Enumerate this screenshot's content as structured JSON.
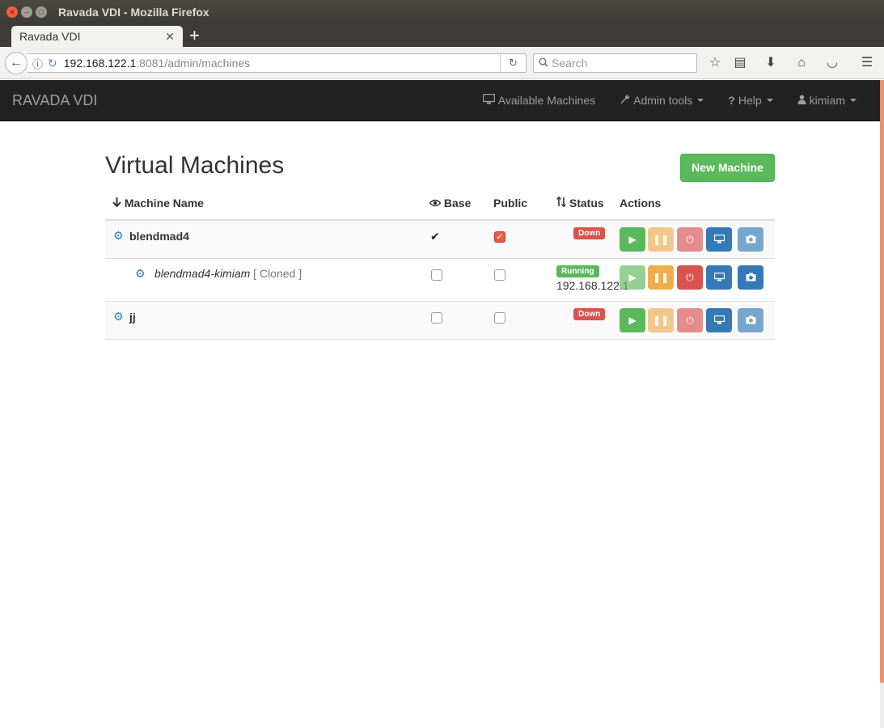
{
  "window": {
    "title": "Ravada VDI - Mozilla Firefox"
  },
  "browser": {
    "tab_title": "Ravada VDI",
    "url_host": "192.168.122.1",
    "url_path": ":8081/admin/machines",
    "search_placeholder": "Search"
  },
  "app": {
    "brand": "RAVADA VDI",
    "nav": {
      "available": "Available Machines",
      "admin": "Admin tools",
      "help": "Help",
      "user": "kimiam"
    }
  },
  "main": {
    "title": "Virtual Machines",
    "new_button": "New Machine",
    "columns": {
      "name": "Machine Name",
      "base": "Base",
      "public": "Public",
      "status": "Status",
      "actions": "Actions"
    },
    "machines": [
      {
        "name": "blendmad4",
        "is_base": true,
        "is_public": true,
        "status": "Down",
        "ip": ""
      },
      {
        "name": "blendmad4-kimiam",
        "clone_tag": "[ Cloned ]",
        "is_base": false,
        "is_public": false,
        "status": "Running",
        "ip": "192.168.122.1"
      },
      {
        "name": "jj",
        "is_base": false,
        "is_public": false,
        "status": "Down",
        "ip": ""
      }
    ]
  },
  "colors": {
    "success": "#5cb85c",
    "warning": "#f0ad4e",
    "danger": "#d9534f",
    "primary": "#337ab7",
    "navbar": "#222222"
  }
}
